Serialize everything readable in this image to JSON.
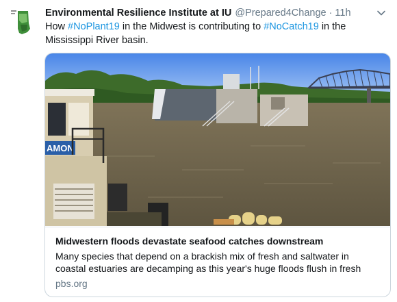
{
  "tweet": {
    "author_name": "Environmental Resilience Institute at IU",
    "handle": "@Prepared4Change",
    "separator": "·",
    "time": "11h",
    "text_part1": "How ",
    "hashtag1": "#NoPlant19",
    "text_part2": " in the Midwest is contributing to ",
    "hashtag2": "#NoCatch19",
    "text_part3": " in the Mississippi River basin."
  },
  "card": {
    "image_sign_text": "AMON",
    "title": "Midwestern floods devastate seafood catches downstream",
    "description": "Many species that depend on a brackish mix of fresh and saltwater in coastal estuaries are decamping as this year's huge floods flush in fresh",
    "domain": "pbs.org"
  },
  "icons": {
    "avatar": "indiana-map-logo",
    "caret": "chevron-down-icon"
  },
  "colors": {
    "link": "#1b95e0",
    "secondary_text": "#657786",
    "border": "#ccd6dd"
  }
}
